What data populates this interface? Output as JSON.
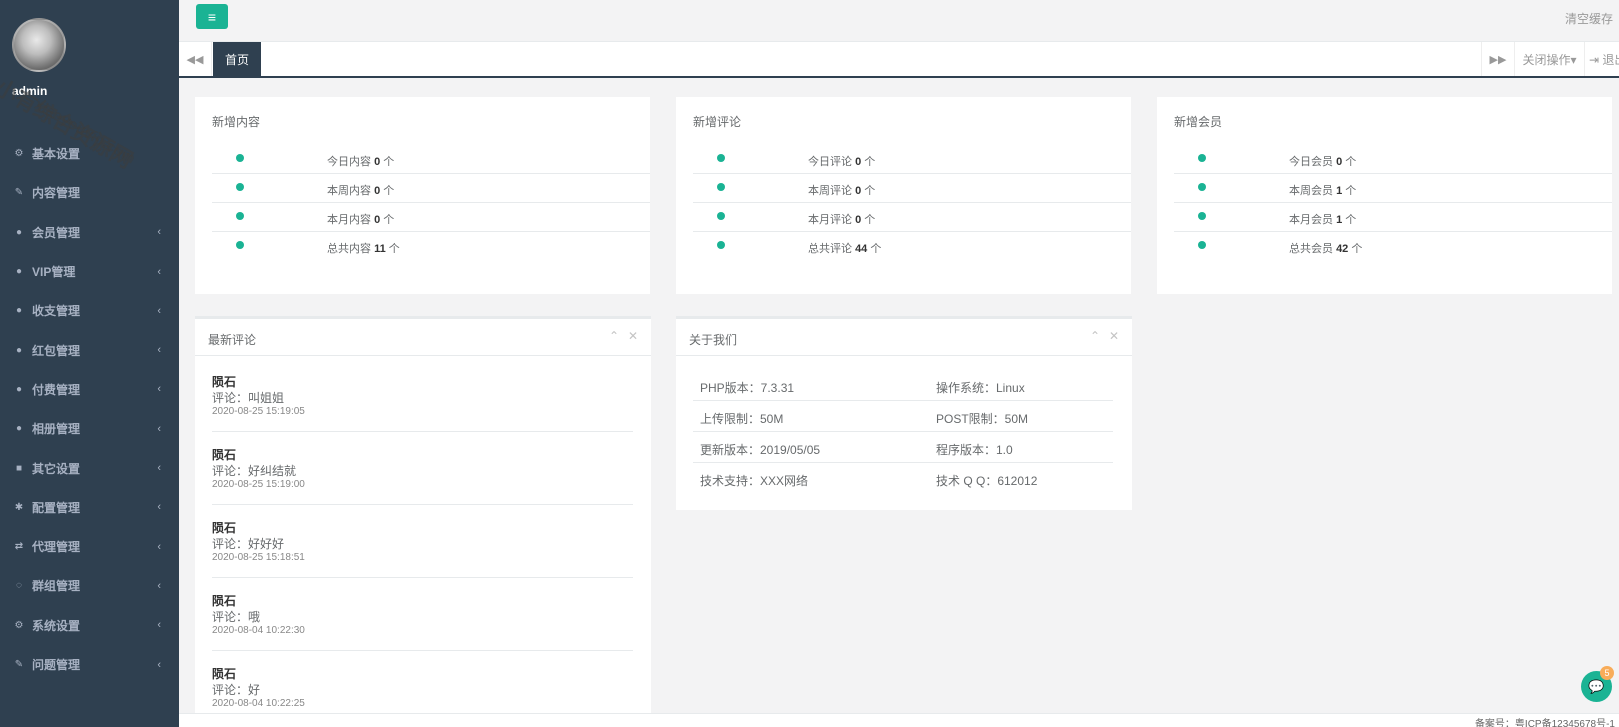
{
  "sidebar": {
    "admin_name": "admin",
    "items": [
      {
        "label": "基本设置",
        "icon": "gear-icon",
        "glyph": "⚙",
        "arrow": ""
      },
      {
        "label": "内容管理",
        "icon": "edit-icon",
        "glyph": "✎",
        "arrow": ""
      },
      {
        "label": "会员管理",
        "icon": "user-icon",
        "glyph": "●",
        "arrow": "‹"
      },
      {
        "label": "VIP管理",
        "icon": "user-icon",
        "glyph": "●",
        "arrow": "‹"
      },
      {
        "label": "收支管理",
        "icon": "user-icon",
        "glyph": "●",
        "arrow": "‹"
      },
      {
        "label": "红包管理",
        "icon": "user-icon",
        "glyph": "●",
        "arrow": "‹"
      },
      {
        "label": "付费管理",
        "icon": "user-icon",
        "glyph": "●",
        "arrow": "‹"
      },
      {
        "label": "相册管理",
        "icon": "user-icon",
        "glyph": "●",
        "arrow": "‹"
      },
      {
        "label": "其它设置",
        "icon": "book-icon",
        "glyph": "■",
        "arrow": "‹"
      },
      {
        "label": "配置管理",
        "icon": "asterisk-icon",
        "glyph": "✱",
        "arrow": "‹"
      },
      {
        "label": "代理管理",
        "icon": "exchange-icon",
        "glyph": "⇄",
        "arrow": "‹"
      },
      {
        "label": "群组管理",
        "icon": "comment-icon",
        "glyph": "◌",
        "arrow": "‹"
      },
      {
        "label": "系统设置",
        "icon": "cogs-icon",
        "glyph": "⚙",
        "arrow": "‹"
      },
      {
        "label": "问题管理",
        "icon": "edit-icon",
        "glyph": "✎",
        "arrow": "‹"
      }
    ]
  },
  "topbar": {
    "menu_glyph": "≡",
    "clear_cache": "清空缓存"
  },
  "tabs": {
    "prev_glyph": "◀◀",
    "home": "首页",
    "next_glyph": "▶▶",
    "close_ops": "关闭操作▾",
    "logout": "⇥ 退出"
  },
  "stats": [
    {
      "title": "新增内容",
      "rows": [
        {
          "label": "今日内容",
          "value": "0",
          "unit": "个"
        },
        {
          "label": "本周内容",
          "value": "0",
          "unit": "个"
        },
        {
          "label": "本月内容",
          "value": "0",
          "unit": "个"
        },
        {
          "label": "总共内容",
          "value": "11",
          "unit": "个"
        }
      ]
    },
    {
      "title": "新增评论",
      "rows": [
        {
          "label": "今日评论",
          "value": "0",
          "unit": "个"
        },
        {
          "label": "本周评论",
          "value": "0",
          "unit": "个"
        },
        {
          "label": "本月评论",
          "value": "0",
          "unit": "个"
        },
        {
          "label": "总共评论",
          "value": "44",
          "unit": "个"
        }
      ]
    },
    {
      "title": "新增会员",
      "rows": [
        {
          "label": "今日会员",
          "value": "0",
          "unit": "个"
        },
        {
          "label": "本周会员",
          "value": "1",
          "unit": "个"
        },
        {
          "label": "本月会员",
          "value": "1",
          "unit": "个"
        },
        {
          "label": "总共会员",
          "value": "42",
          "unit": "个"
        }
      ]
    }
  ],
  "latest_comments": {
    "title": "最新评论",
    "items": [
      {
        "author": "陨石",
        "body": "评论：叫姐姐",
        "time": "2020-08-25 15:19:05"
      },
      {
        "author": "陨石",
        "body": "评论：好纠结就",
        "time": "2020-08-25 15:19:00"
      },
      {
        "author": "陨石",
        "body": "评论：好好好",
        "time": "2020-08-25 15:18:51"
      },
      {
        "author": "陨石",
        "body": "评论：哦",
        "time": "2020-08-04 10:22:30"
      },
      {
        "author": "陨石",
        "body": "评论：好",
        "time": "2020-08-04 10:22:25"
      }
    ]
  },
  "about": {
    "title": "关于我们",
    "rows": [
      {
        "left": "PHP版本：7.3.31",
        "right": "操作系统：Linux"
      },
      {
        "left": "上传限制：50M",
        "right": "POST限制：50M"
      },
      {
        "left": "更新版本：2019/05/05",
        "right": "程序版本：1.0"
      },
      {
        "left": "技术支持：XXX网络",
        "right": "技术 Q Q：612012"
      }
    ]
  },
  "panel_controls": {
    "collapse": "⌃",
    "close": "✕"
  },
  "footer": {
    "text": "备案号：粤ICP备12345678号-1"
  },
  "chat": {
    "glyph": "💬",
    "badge": "5"
  },
  "watermark": {
    "line1": "小有综合资源网",
    "line2": "xiaoyouvip.com"
  },
  "colors": {
    "sidebar": "#2f4050",
    "accent": "#1ab394",
    "badge": "#f8ac59"
  }
}
